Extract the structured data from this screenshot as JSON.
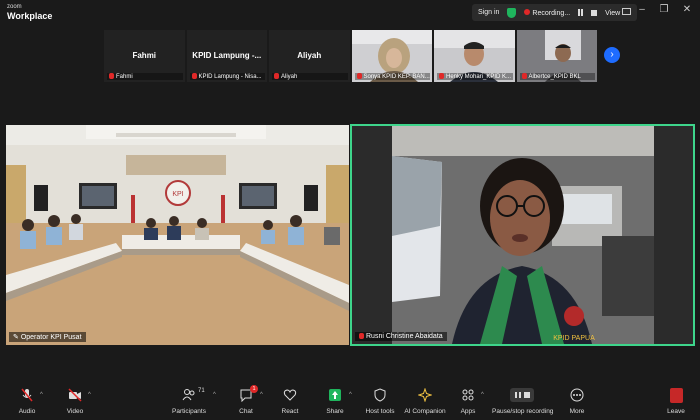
{
  "app": {
    "brand_top": "zoom",
    "brand_bottom": "Workplace"
  },
  "top_controls": {
    "sign_in": "Sign in",
    "recording": "Recording...",
    "view": "View"
  },
  "thumbnails": [
    {
      "name": "Fahmi",
      "label": "Fahmi",
      "muted": true,
      "video": false
    },
    {
      "name": "KPID Lampung -...",
      "label": "KPID Lampung - Nisa...",
      "muted": true,
      "video": false
    },
    {
      "name": "Aliyah",
      "label": "Aliyah",
      "muted": true,
      "video": false
    },
    {
      "name": "",
      "label": "Sonya KPID KEP. BAN...",
      "muted": true,
      "video": true
    },
    {
      "name": "",
      "label": "Henky Mohari_KPID K...",
      "muted": true,
      "video": true
    },
    {
      "name": "",
      "label": "Albertce_KPID BKL",
      "muted": true,
      "video": true
    }
  ],
  "tiles": {
    "left": {
      "name": "Operator KPI Pusat"
    },
    "right": {
      "name": "Rusni Christine Abaidata"
    }
  },
  "toolbar": {
    "audio": "Audio",
    "video": "Video",
    "participants": "Participants",
    "participants_count": "71",
    "chat": "Chat",
    "chat_badge": "1",
    "react": "React",
    "share": "Share",
    "host_tools": "Host tools",
    "ai_companion": "AI Companion",
    "apps": "Apps",
    "pause_recording": "Pause/stop recording",
    "more": "More",
    "leave": "Leave"
  },
  "colors": {
    "active_speaker": "#3ed58b",
    "accent": "#1e6cff",
    "alert": "#e02828",
    "share": "#1fb55d"
  }
}
